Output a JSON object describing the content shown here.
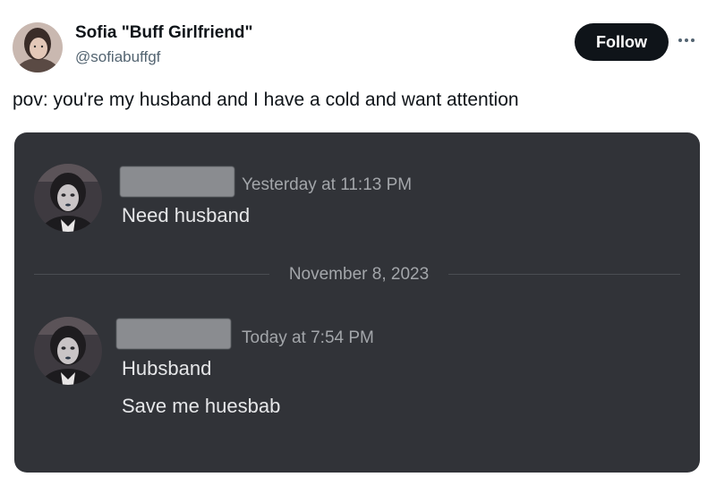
{
  "author": {
    "display_name": "Sofia \"Buff Girlfriend\"",
    "handle": "@sofiabuffgf",
    "avatar_icon": "profile-photo"
  },
  "actions": {
    "follow_label": "Follow",
    "more_icon": "ellipsis-icon"
  },
  "tweet": {
    "text": "pov: you're my husband and I have a cold and want attention"
  },
  "chat": {
    "background": "#313338",
    "messages": [
      {
        "timestamp": "Yesterday at 11:13 PM",
        "lines": [
          "Need husband"
        ]
      },
      {
        "timestamp": "Today at 7:54 PM",
        "lines": [
          "Hubsband",
          "Save me huesbab"
        ]
      }
    ],
    "date_divider": "November 8, 2023"
  }
}
